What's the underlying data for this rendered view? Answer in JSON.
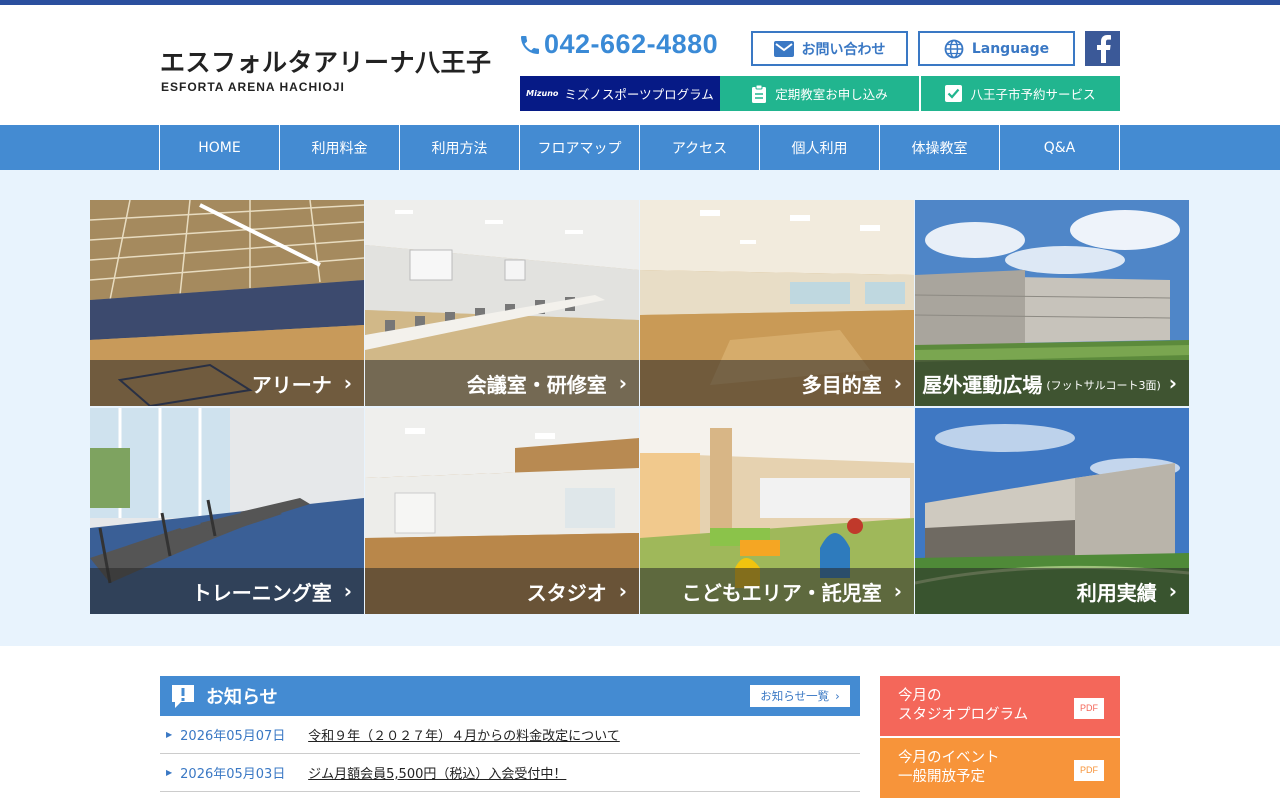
{
  "header": {
    "logo_jp": "エスフォルタアリーナ八王子",
    "logo_en": "ESFORTA ARENA HACHIOJI",
    "phone": "042-662-4880",
    "contact_label": "お問い合わせ",
    "language_label": "Language",
    "sub_buttons": {
      "mizuno_mark": "Mizuno",
      "mizuno": "ミズノスポーツプログラム",
      "regular": "定期教室お申し込み",
      "reserve": "八王子市予約サービス"
    }
  },
  "nav": [
    "HOME",
    "利用料金",
    "利用方法",
    "フロアマップ",
    "アクセス",
    "個人利用",
    "体操教室",
    "Q&A"
  ],
  "facilities": [
    {
      "label": "アリーナ",
      "sub": ""
    },
    {
      "label": "会議室・研修室",
      "sub": ""
    },
    {
      "label": "多目的室",
      "sub": ""
    },
    {
      "label": "屋外運動広場",
      "sub": "(フットサルコート3面)"
    },
    {
      "label": "トレーニング室",
      "sub": ""
    },
    {
      "label": "スタジオ",
      "sub": ""
    },
    {
      "label": "こどもエリア・託児室",
      "sub": ""
    },
    {
      "label": "利用実績",
      "sub": ""
    }
  ],
  "news": {
    "title": "お知らせ",
    "more_label": "お知らせ一覧",
    "items": [
      {
        "date": "2026年05月07日",
        "text": "令和９年（２０２７年）４月からの料金改定について"
      },
      {
        "date": "2026年05月03日",
        "text": "ジム月額会員5,500円（税込）入会受付中！"
      }
    ]
  },
  "side": {
    "studio": {
      "line1": "今月の",
      "line2": "スタジオプログラム",
      "badge": "PDF"
    },
    "event": {
      "line1": "今月のイベント",
      "line2": "一般開放予定",
      "badge": "PDF"
    }
  },
  "colors": {
    "brand_blue": "#448bd2",
    "nav_blue": "#448bd2",
    "mizuno_navy": "#061a86",
    "green": "#21b58f",
    "studio_red": "#f4675a",
    "event_orange": "#f7943a",
    "facebook": "#3b5998"
  }
}
